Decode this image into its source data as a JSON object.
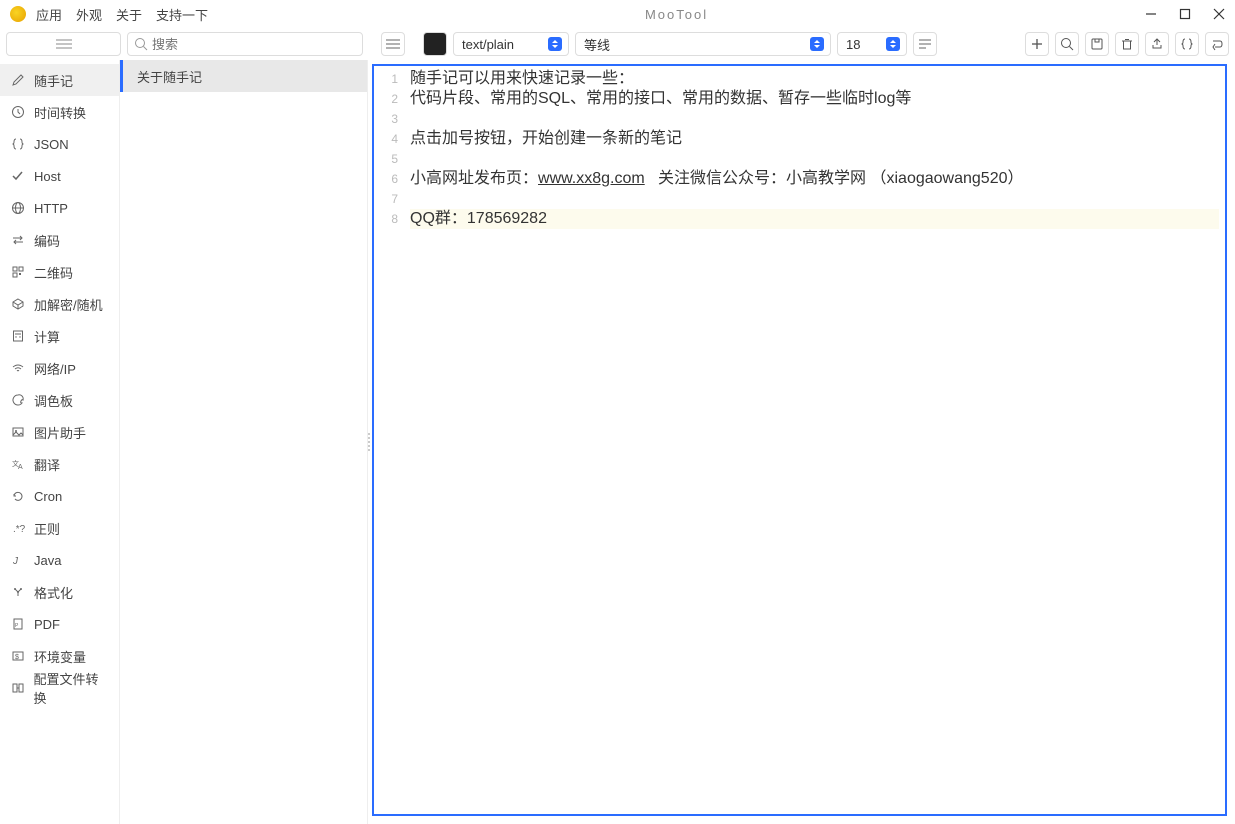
{
  "titlebar": {
    "menus": [
      "应用",
      "外观",
      "关于",
      "支持一下"
    ],
    "title": "MooTool"
  },
  "toolbar": {
    "search_placeholder": "搜索",
    "syntax": "text/plain",
    "font": "等线",
    "fontsize": "18"
  },
  "sidebar": {
    "items": [
      {
        "label": "随手记",
        "icon": "pencil-icon",
        "active": true
      },
      {
        "label": "时间转换",
        "icon": "clock-icon"
      },
      {
        "label": "JSON",
        "icon": "braces-icon"
      },
      {
        "label": "Host",
        "icon": "check-icon"
      },
      {
        "label": "HTTP",
        "icon": "globe-icon"
      },
      {
        "label": "编码",
        "icon": "swap-icon"
      },
      {
        "label": "二维码",
        "icon": "qr-icon"
      },
      {
        "label": "加解密/随机",
        "icon": "cube-icon"
      },
      {
        "label": "计算",
        "icon": "calc-icon"
      },
      {
        "label": "网络/IP",
        "icon": "wifi-icon"
      },
      {
        "label": "调色板",
        "icon": "palette-icon"
      },
      {
        "label": "图片助手",
        "icon": "image-icon"
      },
      {
        "label": "翻译",
        "icon": "translate-icon"
      },
      {
        "label": "Cron",
        "icon": "refresh-icon"
      },
      {
        "label": "正则",
        "icon": "regex-icon"
      },
      {
        "label": "Java",
        "icon": "java-icon"
      },
      {
        "label": "格式化",
        "icon": "format-icon"
      },
      {
        "label": "PDF",
        "icon": "pdf-icon"
      },
      {
        "label": "环境变量",
        "icon": "env-icon"
      },
      {
        "label": "配置文件转换",
        "icon": "config-icon"
      }
    ]
  },
  "notelist": {
    "items": [
      {
        "label": "关于随手记",
        "active": true
      }
    ]
  },
  "editor": {
    "lines": [
      "随手记可以用来快速记录一些：",
      "代码片段、常用的SQL、常用的接口、常用的数据、暂存一些临时log等",
      "",
      "点击加号按钮，开始创建一条新的笔记",
      "",
      "",
      "",
      "QQ群：178569282"
    ],
    "line6_prefix": "小高网址发布页：",
    "line6_link": "www.xx8g.com",
    "line6_suffix": "   关注微信公众号：小高教学网 （xiaogaowang520）",
    "highlight_line": 8
  }
}
